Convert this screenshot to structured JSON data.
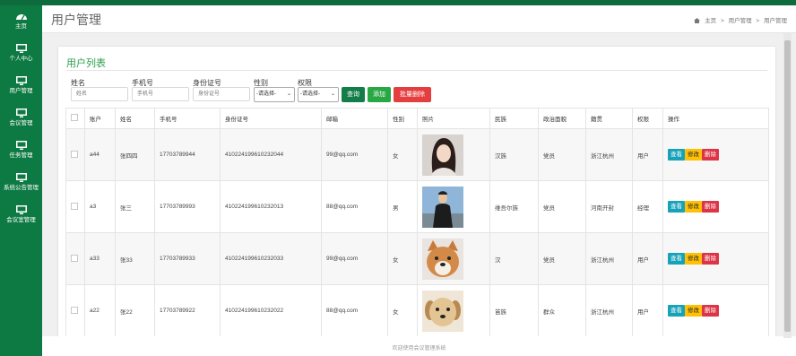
{
  "sidebar": {
    "items": [
      {
        "label": "主页",
        "icon": "gauge-icon"
      },
      {
        "label": "个人中心",
        "icon": "monitor-icon"
      },
      {
        "label": "用户管理",
        "icon": "monitor-icon"
      },
      {
        "label": "会议管理",
        "icon": "monitor-icon"
      },
      {
        "label": "任务管理",
        "icon": "monitor-icon"
      },
      {
        "label": "系统公告管理",
        "icon": "monitor-icon"
      },
      {
        "label": "会议室管理",
        "icon": "monitor-icon"
      }
    ]
  },
  "header": {
    "title": "用户管理",
    "breadcrumb": {
      "home": "主页",
      "sep": ">",
      "level1": "用户管理",
      "level2": "用户管理"
    }
  },
  "panel": {
    "title": "用户列表",
    "filters": {
      "account_label": "姓名",
      "account_placeholder": "姓名",
      "phone_label": "手机号",
      "phone_placeholder": "手机号",
      "idcard_label": "身份证号",
      "idcard_placeholder": "身份证号",
      "gender_label": "性别",
      "gender_value": "-请选择-",
      "role_label": "权限",
      "role_value": "-请选择-"
    },
    "buttons": {
      "query": "查询",
      "add": "添加",
      "batch_delete": "批量删除"
    }
  },
  "table": {
    "headers": [
      "账户",
      "姓名",
      "手机号",
      "身份证号",
      "邮箱",
      "性别",
      "照片",
      "民族",
      "政治面貌",
      "籍贯",
      "权限",
      "操作"
    ],
    "actions": {
      "view": "查看",
      "edit": "修改",
      "delete": "删除"
    },
    "rows": [
      {
        "account": "a44",
        "name": "张四四",
        "phone": "17703789944",
        "idcard": "410224199610232044",
        "email": "99@qq.com",
        "gender": "女",
        "photo": "woman-portrait",
        "ethnicity": "汉族",
        "political": "党员",
        "native_place": "浙江杭州",
        "role": "用户"
      },
      {
        "account": "a3",
        "name": "张三",
        "phone": "17703789993",
        "idcard": "410224199610232013",
        "email": "88@qq.com",
        "gender": "男",
        "photo": "man-portrait",
        "ethnicity": "维吾尔族",
        "political": "党员",
        "native_place": "河南开封",
        "role": "经理"
      },
      {
        "account": "a33",
        "name": "张33",
        "phone": "17703789933",
        "idcard": "410224199610232033",
        "email": "99@qq.com",
        "gender": "女",
        "photo": "shiba-dog",
        "ethnicity": "汉",
        "political": "党员",
        "native_place": "浙江杭州",
        "role": "用户"
      },
      {
        "account": "a22",
        "name": "张22",
        "phone": "17703789922",
        "idcard": "410224199610232022",
        "email": "88@qq.com",
        "gender": "女",
        "photo": "puppy",
        "ethnicity": "苗族",
        "political": "群众",
        "native_place": "浙江杭州",
        "role": "用户"
      }
    ]
  },
  "footer": {
    "text": "欢迎使用会议管理系统"
  },
  "colors": {
    "sidebar": "#0e7a43",
    "accent": "#2a9d4d",
    "view": "#17a2b8",
    "edit": "#ffc107",
    "delete": "#dc3545"
  }
}
